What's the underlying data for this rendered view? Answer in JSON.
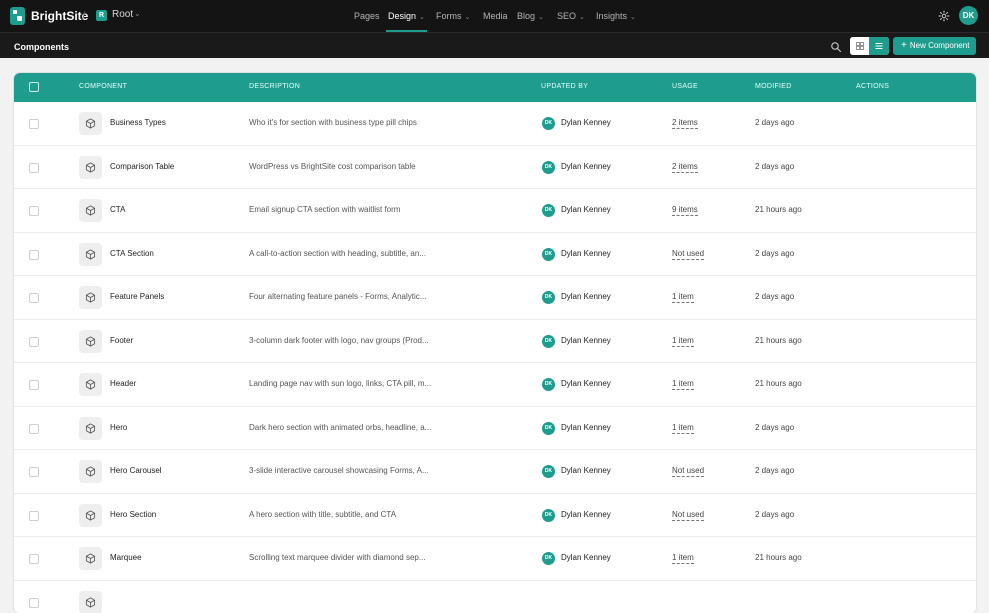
{
  "app": {
    "brand": "BrightSite",
    "site_badge": "R",
    "site_name": "Root",
    "accent_color": "#1e9c8e"
  },
  "nav": [
    {
      "label": "Pages",
      "has_caret": false,
      "active": false
    },
    {
      "label": "Design",
      "has_caret": true,
      "active": true
    },
    {
      "label": "Forms",
      "has_caret": true,
      "active": false
    },
    {
      "label": "Media",
      "has_caret": false,
      "active": false
    },
    {
      "label": "Blog",
      "has_caret": true,
      "active": false
    },
    {
      "label": "SEO",
      "has_caret": true,
      "active": false
    },
    {
      "label": "Insights",
      "has_caret": true,
      "active": false
    }
  ],
  "user": {
    "initials": "DK"
  },
  "subbar": {
    "title": "Components",
    "new_button": "New Component"
  },
  "table": {
    "headers": {
      "component": "COMPONENT",
      "description": "DESCRIPTION",
      "updated_by": "UPDATED BY",
      "usage": "USAGE",
      "modified": "MODIFIED",
      "actions": "ACTIONS"
    },
    "rows": [
      {
        "name": "Business Types",
        "description": "Who it's for section with business type pill chips",
        "user_initials": "DK",
        "user": "Dylan Kenney",
        "usage": "2 items",
        "modified": "2 days ago"
      },
      {
        "name": "Comparison Table",
        "description": "WordPress vs BrightSite cost comparison table",
        "user_initials": "DK",
        "user": "Dylan Kenney",
        "usage": "2 items",
        "modified": "2 days ago"
      },
      {
        "name": "CTA",
        "description": "Email signup CTA section with waitlist form",
        "user_initials": "DK",
        "user": "Dylan Kenney",
        "usage": "9 items",
        "modified": "21 hours ago"
      },
      {
        "name": "CTA Section",
        "description": "A call-to-action section with heading, subtitle, an...",
        "user_initials": "DK",
        "user": "Dylan Kenney",
        "usage": "Not used",
        "modified": "2 days ago"
      },
      {
        "name": "Feature Panels",
        "description": "Four alternating feature panels - Forms, Analytic...",
        "user_initials": "DK",
        "user": "Dylan Kenney",
        "usage": "1 item",
        "modified": "2 days ago"
      },
      {
        "name": "Footer",
        "description": "3-column dark footer with logo, nav groups (Prod...",
        "user_initials": "DK",
        "user": "Dylan Kenney",
        "usage": "1 item",
        "modified": "21 hours ago"
      },
      {
        "name": "Header",
        "description": "Landing page nav with sun logo, links, CTA pill, m...",
        "user_initials": "DK",
        "user": "Dylan Kenney",
        "usage": "1 item",
        "modified": "21 hours ago"
      },
      {
        "name": "Hero",
        "description": "Dark hero section with animated orbs, headline, a...",
        "user_initials": "DK",
        "user": "Dylan Kenney",
        "usage": "1 item",
        "modified": "2 days ago"
      },
      {
        "name": "Hero Carousel",
        "description": "3-slide interactive carousel showcasing Forms, A...",
        "user_initials": "DK",
        "user": "Dylan Kenney",
        "usage": "Not used",
        "modified": "2 days ago"
      },
      {
        "name": "Hero Section",
        "description": "A hero section with title, subtitle, and CTA",
        "user_initials": "DK",
        "user": "Dylan Kenney",
        "usage": "Not used",
        "modified": "2 days ago"
      },
      {
        "name": "Marquee",
        "description": "Scrolling text marquee divider with diamond sep...",
        "user_initials": "DK",
        "user": "Dylan Kenney",
        "usage": "1 item",
        "modified": "21 hours ago"
      },
      {
        "name": "",
        "description": "",
        "user_initials": "",
        "user": "",
        "usage": "",
        "modified": ""
      }
    ]
  }
}
